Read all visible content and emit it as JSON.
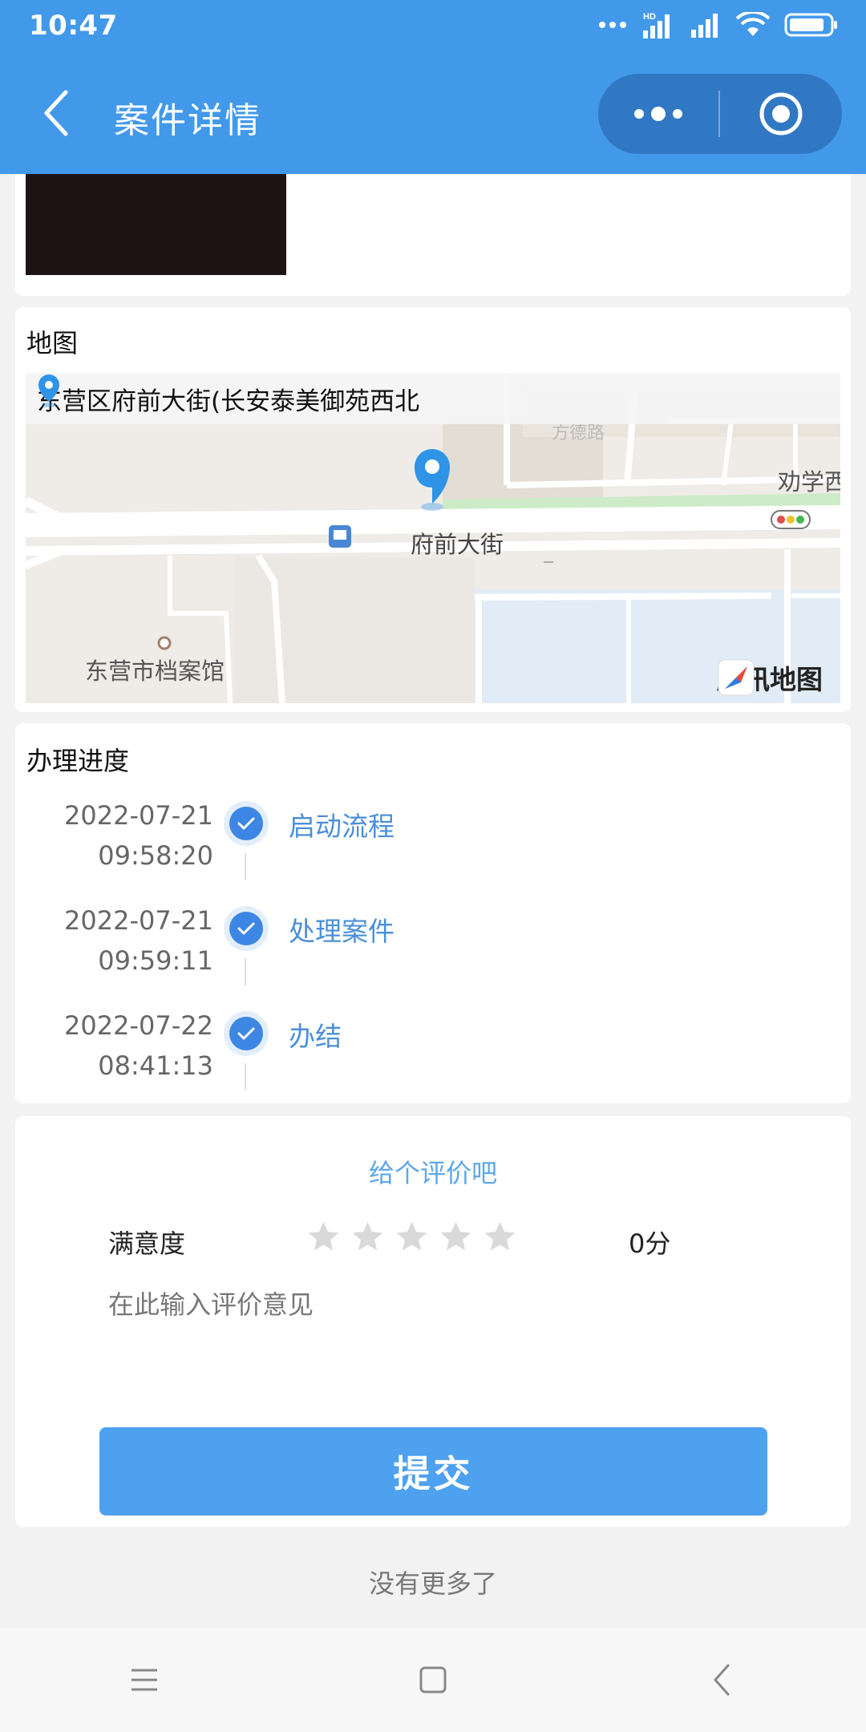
{
  "status_bar": {
    "time": "10:47",
    "hd_label": "HD"
  },
  "nav": {
    "title": "案件详情",
    "back_icon": "chevron-left-icon",
    "more_icon": "more-dots-icon",
    "close_icon": "target-circle-icon"
  },
  "map_section": {
    "title": "地图",
    "address": "东营区府前大街(长安泰美御苑西北",
    "labels": {
      "street": "府前大街",
      "poi": "东营市档案馆",
      "road_right": "劝学西",
      "road_top": "方德路"
    },
    "provider": "腾讯地图"
  },
  "progress": {
    "title": "办理进度",
    "steps": [
      {
        "date": "2022-07-21",
        "time": "09:58:20",
        "label": "启动流程"
      },
      {
        "date": "2022-07-21",
        "time": "09:59:11",
        "label": "处理案件"
      },
      {
        "date": "2022-07-22",
        "time": "08:41:13",
        "label": "办结"
      }
    ]
  },
  "rating": {
    "heading": "给个评价吧",
    "satisfaction_label": "满意度",
    "stars_total": 5,
    "stars_selected": 0,
    "score": "0分",
    "comment_placeholder": "在此输入评价意见",
    "comment_value": "",
    "submit_label": "提交"
  },
  "footer": {
    "no_more": "没有更多了"
  },
  "colors": {
    "header": "#4299ea",
    "capsule": "#3178c4",
    "accent": "#4a8fd8",
    "button": "#4da1ef",
    "star_empty": "#d9d9d9"
  }
}
